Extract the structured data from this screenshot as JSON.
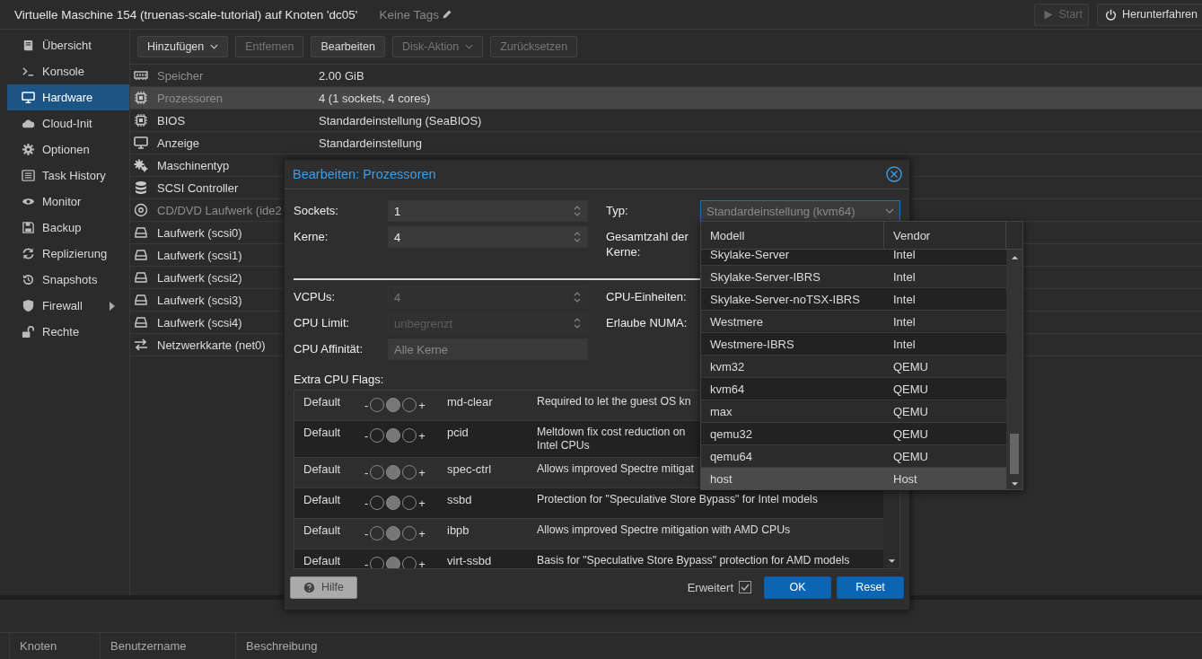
{
  "window": {
    "title": "Virtuelle Maschine 154 (truenas-scale-tutorial) auf Knoten 'dc05'",
    "tags": "Keine Tags"
  },
  "top_buttons": [
    {
      "label": "Start",
      "disabled": true
    },
    {
      "label": "Herunterfahren",
      "disabled": false
    }
  ],
  "sidebar": {
    "items": [
      {
        "label": "Übersicht",
        "selected": false,
        "has_submenu": false
      },
      {
        "label": "Konsole",
        "selected": false,
        "has_submenu": false
      },
      {
        "label": "Hardware",
        "selected": true,
        "has_submenu": false
      },
      {
        "label": "Cloud-Init",
        "selected": false,
        "has_submenu": false
      },
      {
        "label": "Optionen",
        "selected": false,
        "has_submenu": false
      },
      {
        "label": "Task History",
        "selected": false,
        "has_submenu": false
      },
      {
        "label": "Monitor",
        "selected": false,
        "has_submenu": false
      },
      {
        "label": "Backup",
        "selected": false,
        "has_submenu": false
      },
      {
        "label": "Replizierung",
        "selected": false,
        "has_submenu": false
      },
      {
        "label": "Snapshots",
        "selected": false,
        "has_submenu": false
      },
      {
        "label": "Firewall",
        "selected": false,
        "has_submenu": true
      },
      {
        "label": "Rechte",
        "selected": false,
        "has_submenu": false
      }
    ]
  },
  "toolbar": [
    {
      "label": "Hinzufügen",
      "disabled": false,
      "has_menu": true
    },
    {
      "label": "Entfernen",
      "disabled": true,
      "has_menu": false
    },
    {
      "label": "Bearbeiten",
      "disabled": false,
      "has_menu": false
    },
    {
      "label": "Disk-Aktion",
      "disabled": true,
      "has_menu": true
    },
    {
      "label": "Zurücksetzen",
      "disabled": true,
      "has_menu": false
    }
  ],
  "hardware": [
    {
      "name": "Speicher",
      "value": "2.00 GiB",
      "selected": false,
      "dimmed": true
    },
    {
      "name": "Prozessoren",
      "value": "4 (1 sockets, 4 cores)",
      "selected": true,
      "dimmed": true
    },
    {
      "name": "BIOS",
      "value": "Standardeinstellung (SeaBIOS)",
      "selected": false,
      "dimmed": false
    },
    {
      "name": "Anzeige",
      "value": "Standardeinstellung",
      "selected": false,
      "dimmed": false
    },
    {
      "name": "Maschinentyp",
      "selected": false,
      "dimmed": false
    },
    {
      "name": "SCSI Controller",
      "selected": false,
      "dimmed": false
    },
    {
      "name": "CD/DVD Laufwerk (ide2",
      "selected": false,
      "dimmed": true
    },
    {
      "name": "Laufwerk (scsi0)",
      "selected": false,
      "dimmed": false
    },
    {
      "name": "Laufwerk (scsi1)",
      "selected": false,
      "dimmed": false
    },
    {
      "name": "Laufwerk (scsi2)",
      "selected": false,
      "dimmed": false
    },
    {
      "name": "Laufwerk (scsi3)",
      "selected": false,
      "dimmed": false
    },
    {
      "name": "Laufwerk (scsi4)",
      "selected": false,
      "dimmed": false
    },
    {
      "name": "Netzwerkkarte (net0)",
      "selected": false,
      "dimmed": false
    }
  ],
  "dialog": {
    "title": "Bearbeiten: Prozessoren",
    "fields_left": [
      {
        "label": "Sockets:",
        "value": "1",
        "disabled": false,
        "spinner": true
      },
      {
        "label": "Kerne:",
        "value": "4",
        "disabled": false,
        "spinner": true
      }
    ],
    "fields_right": [
      {
        "label": "Typ:",
        "placeholder": "Standardeinstellung (kvm64)",
        "focused": true
      },
      {
        "label": "Gesamtzahl der Kerne:"
      }
    ],
    "advanced_left": [
      {
        "label": "VCPUs:",
        "value": "4",
        "disabled": true,
        "spinner": true
      },
      {
        "label": "CPU Limit:",
        "placeholder": "unbegrenzt",
        "disabled": true,
        "spinner": true
      },
      {
        "label": "CPU Affinität:",
        "placeholder": "Alle Kerne",
        "disabled": false,
        "spinner": false
      }
    ],
    "advanced_right": [
      {
        "label": "CPU-Einheiten:"
      },
      {
        "label": "Erlaube NUMA:"
      }
    ],
    "flags_label": "Extra CPU Flags:",
    "flags": [
      {
        "setting": "Default",
        "minus": "-",
        "plus": "+",
        "switch": [
          {
            "selected": false
          },
          {
            "selected": true
          },
          {
            "selected": false
          }
        ],
        "name": "md-clear",
        "description": "Required to let the guest OS kn"
      },
      {
        "setting": "Default",
        "minus": "-",
        "plus": "+",
        "switch": [
          {
            "selected": false
          },
          {
            "selected": true
          },
          {
            "selected": false
          }
        ],
        "name": "pcid",
        "description": "Meltdown fix cost reduction on\nIntel CPUs"
      },
      {
        "setting": "Default",
        "minus": "-",
        "plus": "+",
        "switch": [
          {
            "selected": false
          },
          {
            "selected": true
          },
          {
            "selected": false
          }
        ],
        "name": "spec-ctrl",
        "description": "Allows improved Spectre mitigat"
      },
      {
        "setting": "Default",
        "minus": "-",
        "plus": "+",
        "switch": [
          {
            "selected": false
          },
          {
            "selected": true
          },
          {
            "selected": false
          }
        ],
        "name": "ssbd",
        "description": "Protection for \"Speculative Store Bypass\" for Intel models"
      },
      {
        "setting": "Default",
        "minus": "-",
        "plus": "+",
        "switch": [
          {
            "selected": false
          },
          {
            "selected": true
          },
          {
            "selected": false
          }
        ],
        "name": "ibpb",
        "description": "Allows improved Spectre mitigation with AMD CPUs"
      },
      {
        "setting": "Default",
        "minus": "-",
        "plus": "+",
        "switch": [
          {
            "selected": false
          },
          {
            "selected": true
          },
          {
            "selected": false
          }
        ],
        "name": "virt-ssbd",
        "description": "Basis for \"Speculative Store Bypass\" protection for AMD models"
      }
    ],
    "help_button": "Hilfe",
    "advanced": {
      "label": "Erweitert",
      "checked": true
    },
    "ok_button": "OK",
    "reset_button": "Reset"
  },
  "cpu_dropdown": {
    "columns": [
      "Modell",
      "Vendor"
    ],
    "rows": [
      {
        "model": "Skylake-Server",
        "vendor": "Intel",
        "hovered": false
      },
      {
        "model": "Skylake-Server-IBRS",
        "vendor": "Intel",
        "hovered": false
      },
      {
        "model": "Skylake-Server-noTSX-IBRS",
        "vendor": "Intel",
        "hovered": false
      },
      {
        "model": "Westmere",
        "vendor": "Intel",
        "hovered": false
      },
      {
        "model": "Westmere-IBRS",
        "vendor": "Intel",
        "hovered": false
      },
      {
        "model": "kvm32",
        "vendor": "QEMU",
        "hovered": false
      },
      {
        "model": "kvm64",
        "vendor": "QEMU",
        "hovered": false
      },
      {
        "model": "max",
        "vendor": "QEMU",
        "hovered": false
      },
      {
        "model": "qemu32",
        "vendor": "QEMU",
        "hovered": false
      },
      {
        "model": "qemu64",
        "vendor": "QEMU",
        "hovered": false
      },
      {
        "model": "host",
        "vendor": "Host",
        "hovered": true
      }
    ]
  },
  "task_table": {
    "columns": [
      "Knoten",
      "Benutzername",
      "Beschreibung"
    ]
  }
}
